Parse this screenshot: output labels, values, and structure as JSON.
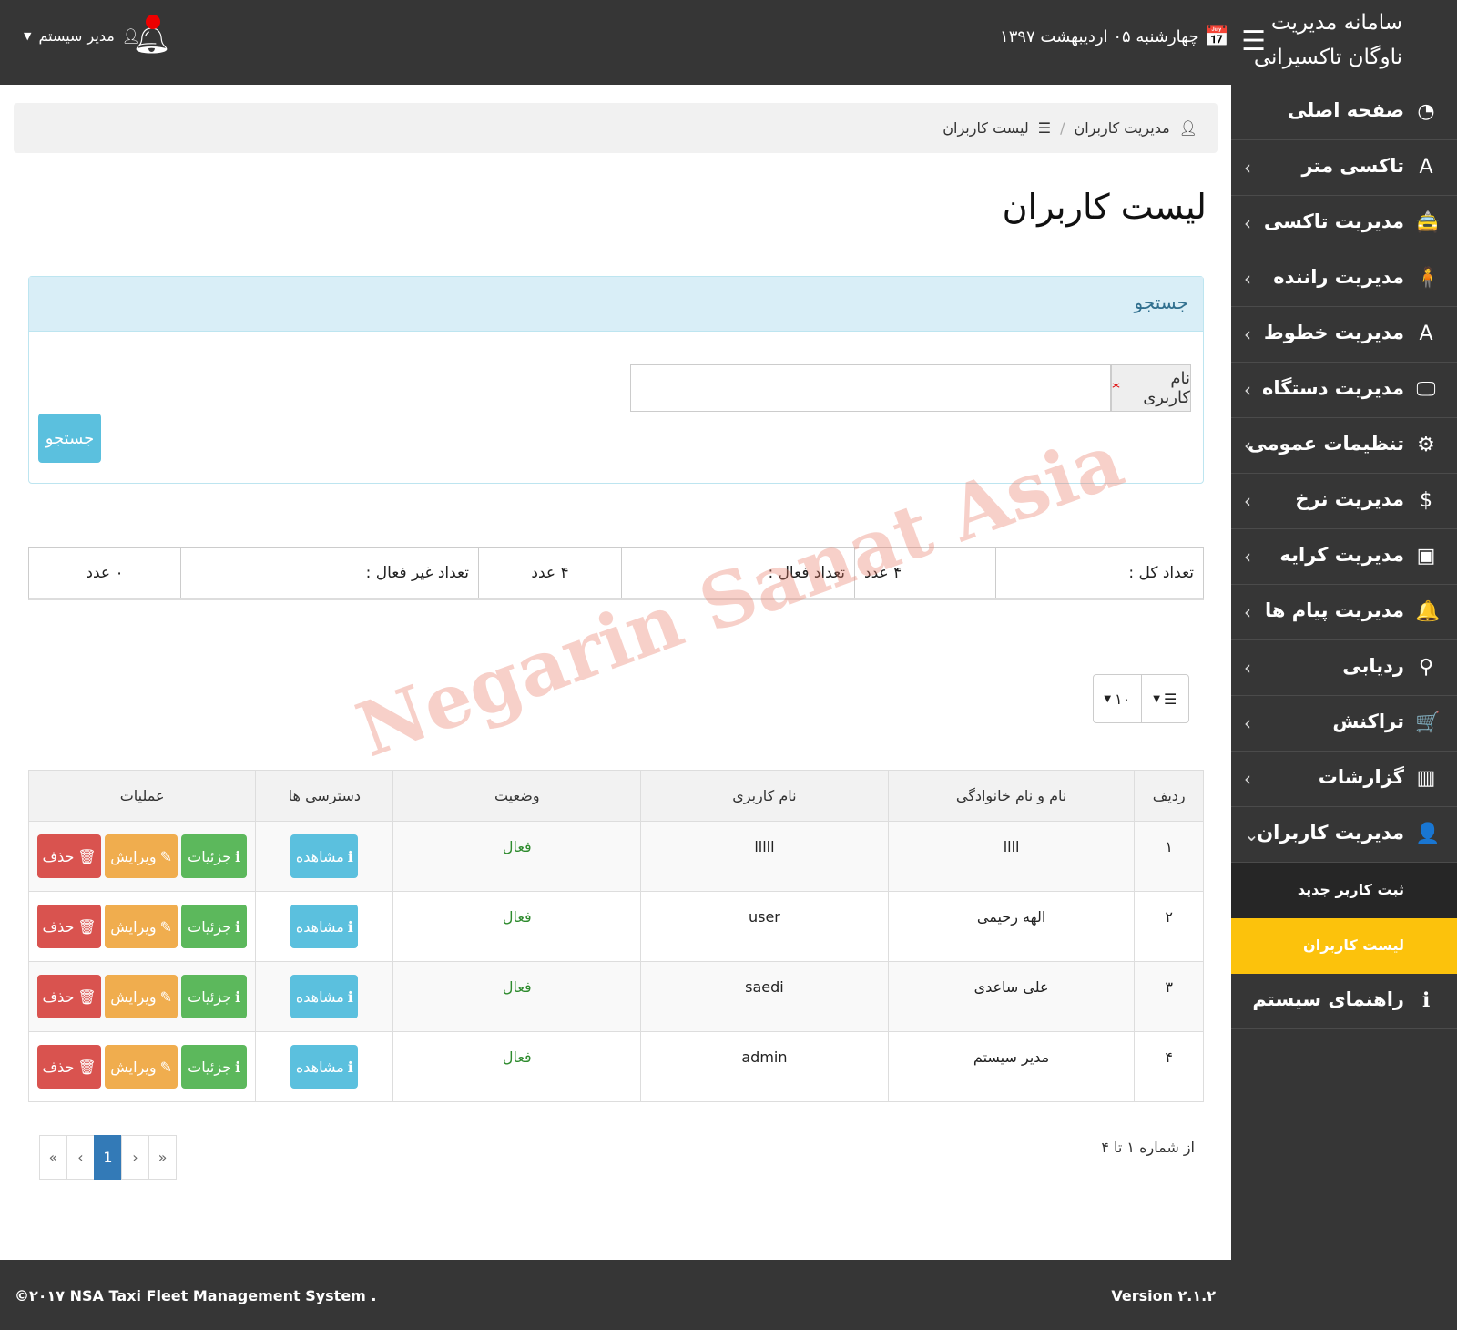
{
  "header": {
    "brand_line1": "سامانه مدیریت",
    "brand_line2": "ناوگان تاکسیرانی",
    "date": "چهارشنبه ۰۵ اردیبهشت ۱۳۹۷",
    "user_name": "مدیر سیستم"
  },
  "sidebar": {
    "items": [
      {
        "label": "صفحه اصلی",
        "icon": "dashboard-icon",
        "glyph": "◔"
      },
      {
        "label": "تاکسی متر",
        "icon": "road-icon",
        "glyph": "A"
      },
      {
        "label": "مدیریت تاکسی",
        "icon": "taxi-icon",
        "glyph": "🚖"
      },
      {
        "label": "مدیریت راننده",
        "icon": "person-icon",
        "glyph": "🧍"
      },
      {
        "label": "مدیریت خطوط",
        "icon": "road-icon",
        "glyph": "A"
      },
      {
        "label": "مدیریت دستگاه",
        "icon": "monitor-icon",
        "glyph": "🖵"
      },
      {
        "label": "تنظیمات عمومی",
        "icon": "gears-icon",
        "glyph": "⚙"
      },
      {
        "label": "مدیریت نرخ",
        "icon": "dollar-icon",
        "glyph": "$"
      },
      {
        "label": "مدیریت کرایه",
        "icon": "money-icon",
        "glyph": "▣"
      },
      {
        "label": "مدیریت پیام ها",
        "icon": "bell-icon",
        "glyph": "🔔"
      },
      {
        "label": "ردیابی",
        "icon": "map-marker-icon",
        "glyph": "⚲"
      },
      {
        "label": "تراکنش",
        "icon": "cart-icon",
        "glyph": "🛒"
      },
      {
        "label": "گزارشات",
        "icon": "bar-chart-icon",
        "glyph": "▥"
      },
      {
        "label": "مدیریت کاربران",
        "icon": "user-icon",
        "glyph": "👤"
      }
    ],
    "sub_items": [
      {
        "label": "ثبت کاربر جدید"
      },
      {
        "label": "لیست کاربران"
      }
    ],
    "help": {
      "label": "راهنمای سیستم",
      "icon": "info-icon",
      "glyph": "ℹ"
    }
  },
  "breadcrumb": {
    "parent": "مدیریت کاربران",
    "current": "لیست کاربران"
  },
  "page_title": "لیست کاربران",
  "search": {
    "panel_title": "جستجو",
    "field_label": "نام کاربری",
    "required_mark": "*",
    "field_value": "",
    "button_label": "جستجو"
  },
  "stats": {
    "total_label": "تعداد کل :",
    "total_value": "۴ عدد",
    "active_label": "تعداد فعال :",
    "active_value": "۴ عدد",
    "inactive_label": "تعداد غیر فعال :",
    "inactive_value": "۰ عدد"
  },
  "page_size": {
    "value": "۱۰"
  },
  "table": {
    "columns": [
      "ردیف",
      "نام و نام خانوادگی",
      "نام کاربری",
      "وضعیت",
      "دسترسی ها",
      "عملیات"
    ],
    "rows": [
      {
        "index": "۱",
        "full_name": "llll",
        "username": "lllll",
        "status": "فعال"
      },
      {
        "index": "۲",
        "full_name": "الهه رحیمی",
        "username": "user",
        "status": "فعال"
      },
      {
        "index": "۳",
        "full_name": "علی ساعدی",
        "username": "saedi",
        "status": "فعال"
      },
      {
        "index": "۴",
        "full_name": "مدیر سیستم",
        "username": "admin",
        "status": "فعال"
      }
    ],
    "view_label": "مشاهده",
    "details_label": "جزئیات",
    "edit_label": "ویرایش",
    "delete_label": "حذف"
  },
  "pagination": {
    "info": "از شماره ۱ تا ۴",
    "first": "«",
    "prev": "‹",
    "current": "1",
    "next": "›",
    "last": "»"
  },
  "footer": {
    "copyright": "©۲۰۱۷ NSA Taxi Fleet Management System .",
    "version": "Version ۲.۱.۲"
  },
  "watermark": "Negarin Sanat Asia",
  "colors": {
    "dark_bar": "#363636",
    "active_sub": "#fcc20c",
    "info": "#5bc0de",
    "success": "#5cb85c",
    "warning": "#f0ad4e",
    "danger": "#d9534f",
    "pager_active": "#337ab7"
  }
}
